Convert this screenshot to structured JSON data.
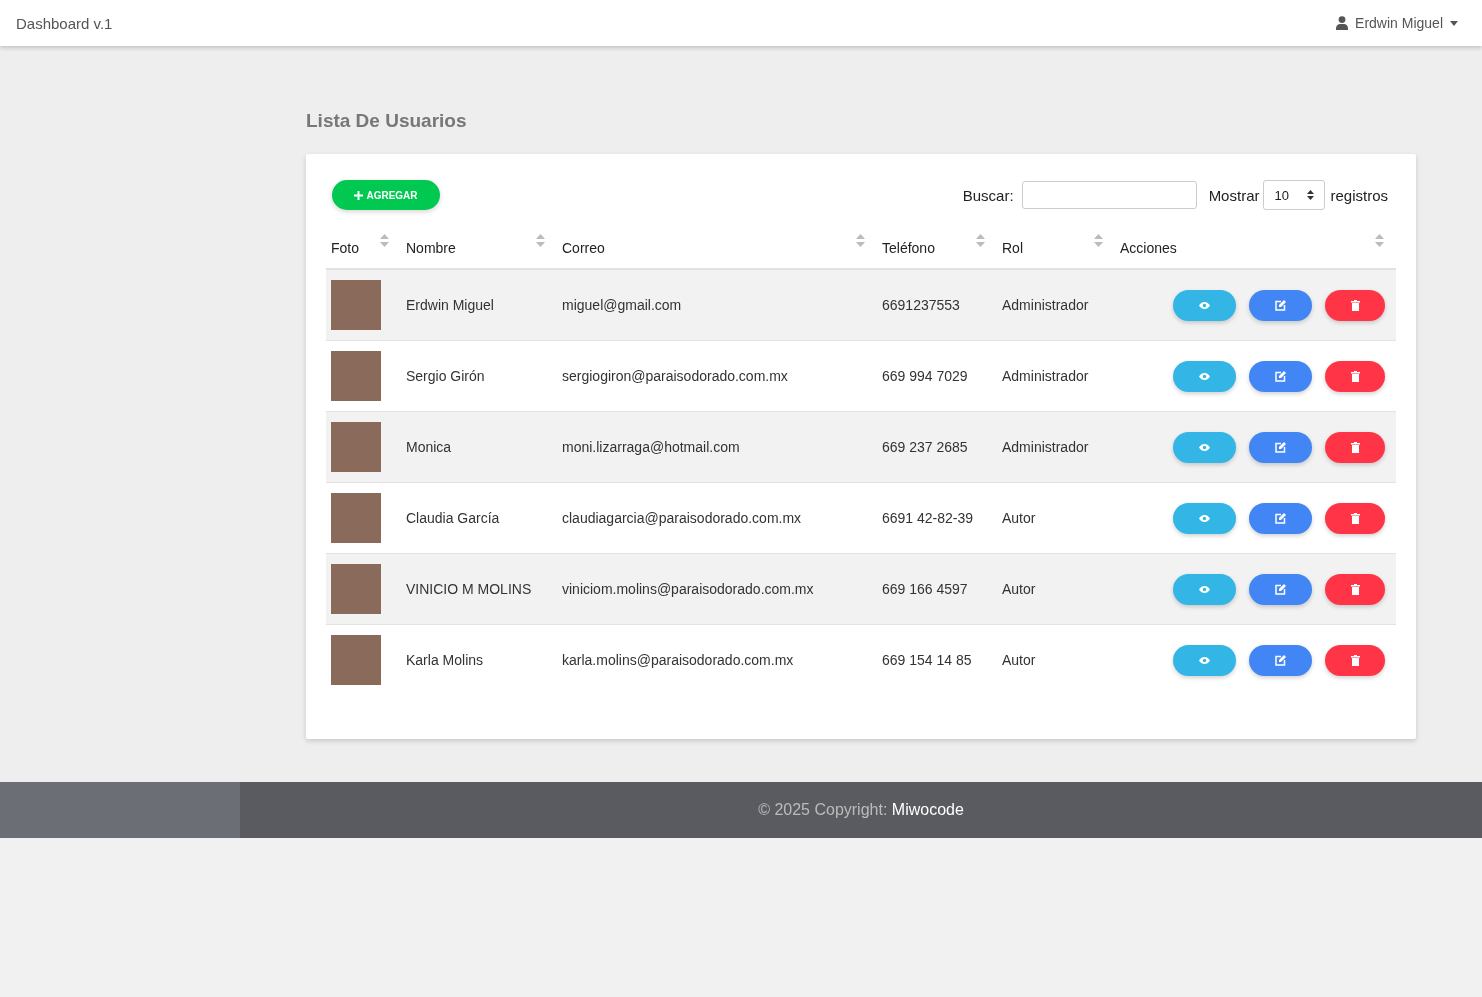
{
  "navbar": {
    "brand": "Dashboard v.1",
    "user": "Erdwin Miguel"
  },
  "page_title": "Lista De Usuarios",
  "toolbar": {
    "add_button": "AGREGAR",
    "search_label": "Buscar:",
    "show_label": "Mostrar",
    "page_size": "10",
    "records_label": "registros"
  },
  "table": {
    "columns": [
      {
        "label": "Foto",
        "sortable": true
      },
      {
        "label": "Nombre",
        "sortable": true
      },
      {
        "label": "Correo",
        "sortable": true
      },
      {
        "label": "Teléfono",
        "sortable": true
      },
      {
        "label": "Rol",
        "sortable": true
      },
      {
        "label": "Acciones",
        "sortable": true
      }
    ],
    "rows": [
      {
        "name": "Erdwin Miguel",
        "email": "miguel@gmail.com",
        "phone": "6691237553",
        "role": "Administrador"
      },
      {
        "name": "Sergio Girón",
        "email": "sergiogiron@paraisodorado.com.mx",
        "phone": "669 994 7029",
        "role": "Administrador"
      },
      {
        "name": "Monica",
        "email": "moni.lizarraga@hotmail.com",
        "phone": "669 237 2685",
        "role": "Administrador"
      },
      {
        "name": "Claudia García",
        "email": "claudiagarcia@paraisodorado.com.mx",
        "phone": "6691 42-82-39",
        "role": "Autor"
      },
      {
        "name": "VINICIO M MOLINS",
        "email": "viniciom.molins@paraisodorado.com.mx",
        "phone": "669 166 4597",
        "role": "Autor"
      },
      {
        "name": "Karla Molins",
        "email": "karla.molins@paraisodorado.com.mx",
        "phone": "669 154 14 85",
        "role": "Autor"
      }
    ]
  },
  "footer": {
    "copyright": "© 2025 Copyright:",
    "brand": "Miwocode"
  }
}
